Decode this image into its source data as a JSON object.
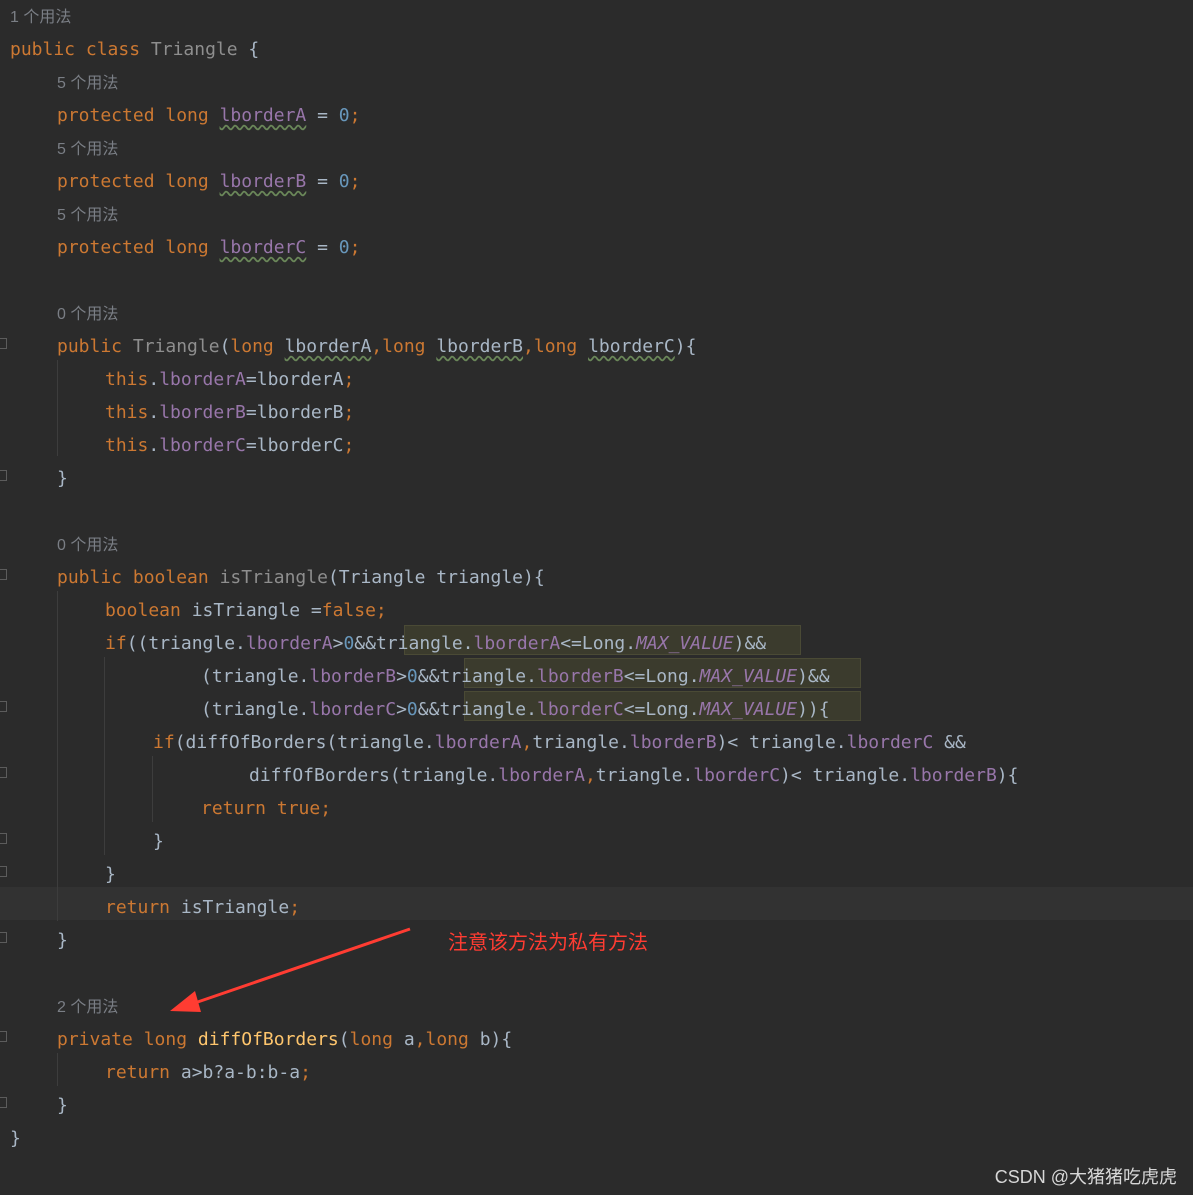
{
  "editor": {
    "colors": {
      "background": "#2b2b2b",
      "keyword": "#cc7832",
      "text": "#a9b7c6",
      "field": "#9876aa",
      "number": "#6897bb",
      "method": "#ffc66d",
      "declaration": "#8e8e8e",
      "hint": "#7a7e85"
    },
    "lines": [
      [
        {
          "t": "1 个用法",
          "c": "hint"
        }
      ],
      [
        {
          "t": "public class ",
          "c": "kw"
        },
        {
          "t": "Triangle",
          "c": "dim"
        },
        {
          "t": " {",
          "c": "tx"
        }
      ],
      [
        {
          "t": "5 个用法",
          "c": "hint"
        }
      ],
      [
        {
          "t": "protected long ",
          "c": "kw"
        },
        {
          "t": "lborderA",
          "c": "fldw"
        },
        {
          "t": " = ",
          "c": "tx"
        },
        {
          "t": "0",
          "c": "num"
        },
        {
          "t": ";",
          "c": "kw"
        }
      ],
      [
        {
          "t": "5 个用法",
          "c": "hint"
        }
      ],
      [
        {
          "t": "protected long ",
          "c": "kw"
        },
        {
          "t": "lborderB",
          "c": "fldw"
        },
        {
          "t": " = ",
          "c": "tx"
        },
        {
          "t": "0",
          "c": "num"
        },
        {
          "t": ";",
          "c": "kw"
        }
      ],
      [
        {
          "t": "5 个用法",
          "c": "hint"
        }
      ],
      [
        {
          "t": "protected long ",
          "c": "kw"
        },
        {
          "t": "lborderC",
          "c": "fldw"
        },
        {
          "t": " = ",
          "c": "tx"
        },
        {
          "t": "0",
          "c": "num"
        },
        {
          "t": ";",
          "c": "kw"
        }
      ],
      [],
      [
        {
          "t": "0 个用法",
          "c": "hint"
        }
      ],
      [
        {
          "t": "public ",
          "c": "kw"
        },
        {
          "t": "Triangle",
          "c": "dim"
        },
        {
          "t": "(",
          "c": "tx"
        },
        {
          "t": "long ",
          "c": "kw"
        },
        {
          "t": "lborderA",
          "c": "txw"
        },
        {
          "t": ",",
          "c": "kw"
        },
        {
          "t": "long ",
          "c": "kw"
        },
        {
          "t": "lborderB",
          "c": "txw"
        },
        {
          "t": ",",
          "c": "kw"
        },
        {
          "t": "long ",
          "c": "kw"
        },
        {
          "t": "lborderC",
          "c": "txw"
        },
        {
          "t": "){",
          "c": "tx"
        }
      ],
      [
        {
          "t": "this",
          "c": "kw"
        },
        {
          "t": ".",
          "c": "tx"
        },
        {
          "t": "lborderA",
          "c": "fld"
        },
        {
          "t": "=lborderA",
          "c": "tx"
        },
        {
          "t": ";",
          "c": "kw"
        }
      ],
      [
        {
          "t": "this",
          "c": "kw"
        },
        {
          "t": ".",
          "c": "tx"
        },
        {
          "t": "lborderB",
          "c": "fld"
        },
        {
          "t": "=lborderB",
          "c": "tx"
        },
        {
          "t": ";",
          "c": "kw"
        }
      ],
      [
        {
          "t": "this",
          "c": "kw"
        },
        {
          "t": ".",
          "c": "tx"
        },
        {
          "t": "lborderC",
          "c": "fld"
        },
        {
          "t": "=lborderC",
          "c": "tx"
        },
        {
          "t": ";",
          "c": "kw"
        }
      ],
      [
        {
          "t": "}",
          "c": "tx"
        }
      ],
      [],
      [
        {
          "t": "0 个用法",
          "c": "hint"
        }
      ],
      [
        {
          "t": "public boolean ",
          "c": "kw"
        },
        {
          "t": "isTriangle",
          "c": "dim"
        },
        {
          "t": "(Triangle triangle){",
          "c": "tx"
        }
      ],
      [
        {
          "t": "boolean ",
          "c": "kw"
        },
        {
          "t": "isTriangle =",
          "c": "tx"
        },
        {
          "t": "false;",
          "c": "kw"
        }
      ],
      [
        {
          "t": "if",
          "c": "kw"
        },
        {
          "t": "((triangle.",
          "c": "tx"
        },
        {
          "t": "lborderA",
          "c": "fld"
        },
        {
          "t": ">",
          "c": "tx"
        },
        {
          "t": "0",
          "c": "num"
        },
        {
          "t": "&&triangle.",
          "c": "tx"
        },
        {
          "t": "lborderA",
          "c": "fld"
        },
        {
          "t": "<=Long.",
          "c": "tx"
        },
        {
          "t": "MAX_VALUE",
          "c": "fldi"
        },
        {
          "t": ")&&",
          "c": "tx"
        }
      ],
      [
        {
          "t": "(triangle.",
          "c": "tx"
        },
        {
          "t": "lborderB",
          "c": "fld"
        },
        {
          "t": ">",
          "c": "tx"
        },
        {
          "t": "0",
          "c": "num"
        },
        {
          "t": "&&triangle.",
          "c": "tx"
        },
        {
          "t": "lborderB",
          "c": "fld"
        },
        {
          "t": "<=Long.",
          "c": "tx"
        },
        {
          "t": "MAX_VALUE",
          "c": "fldi"
        },
        {
          "t": ")&&",
          "c": "tx"
        }
      ],
      [
        {
          "t": "(triangle.",
          "c": "tx"
        },
        {
          "t": "lborderC",
          "c": "fld"
        },
        {
          "t": ">",
          "c": "tx"
        },
        {
          "t": "0",
          "c": "num"
        },
        {
          "t": "&&triangle.",
          "c": "tx"
        },
        {
          "t": "lborderC",
          "c": "fld"
        },
        {
          "t": "<=Long.",
          "c": "tx"
        },
        {
          "t": "MAX_VALUE",
          "c": "fldi"
        },
        {
          "t": ")){",
          "c": "tx"
        }
      ],
      [
        {
          "t": "if",
          "c": "kw"
        },
        {
          "t": "(diffOfBorders(triangle.",
          "c": "tx"
        },
        {
          "t": "lborderA",
          "c": "fld"
        },
        {
          "t": ",",
          "c": "kw"
        },
        {
          "t": "triangle.",
          "c": "tx"
        },
        {
          "t": "lborderB",
          "c": "fld"
        },
        {
          "t": ")< triangle.",
          "c": "tx"
        },
        {
          "t": "lborderC",
          "c": "fld"
        },
        {
          "t": " &&",
          "c": "tx"
        }
      ],
      [
        {
          "t": "diffOfBorders(triangle.",
          "c": "tx"
        },
        {
          "t": "lborderA",
          "c": "fld"
        },
        {
          "t": ",",
          "c": "kw"
        },
        {
          "t": "triangle.",
          "c": "tx"
        },
        {
          "t": "lborderC",
          "c": "fld"
        },
        {
          "t": ")< triangle.",
          "c": "tx"
        },
        {
          "t": "lborderB",
          "c": "fld"
        },
        {
          "t": "){",
          "c": "tx"
        }
      ],
      [
        {
          "t": "return true;",
          "c": "kw"
        }
      ],
      [
        {
          "t": "}",
          "c": "tx"
        }
      ],
      [
        {
          "t": "}",
          "c": "tx"
        }
      ],
      [
        {
          "t": "return ",
          "c": "kw"
        },
        {
          "t": "isTriangle",
          "c": "tx"
        },
        {
          "t": ";",
          "c": "kw"
        }
      ],
      [
        {
          "t": "}",
          "c": "tx"
        }
      ],
      [],
      [
        {
          "t": "2 个用法",
          "c": "hint"
        }
      ],
      [
        {
          "t": "private long ",
          "c": "kw"
        },
        {
          "t": "diffOfBorders",
          "c": "mth"
        },
        {
          "t": "(",
          "c": "tx"
        },
        {
          "t": "long ",
          "c": "kw"
        },
        {
          "t": "a",
          "c": "tx"
        },
        {
          "t": ",",
          "c": "kw"
        },
        {
          "t": "long ",
          "c": "kw"
        },
        {
          "t": "b",
          "c": "tx"
        },
        {
          "t": "){",
          "c": "tx"
        }
      ],
      [
        {
          "t": "return ",
          "c": "kw"
        },
        {
          "t": "a>b?a-b:b-a",
          "c": "tx"
        },
        {
          "t": ";",
          "c": "kw"
        }
      ],
      [
        {
          "t": "}",
          "c": "tx"
        }
      ],
      [
        {
          "t": "}",
          "c": "tx"
        }
      ]
    ]
  },
  "annotation": {
    "text": "注意该方法为私有方法",
    "color": "#ff3c32"
  },
  "watermark": "CSDN @大猪猪吃虎虎"
}
